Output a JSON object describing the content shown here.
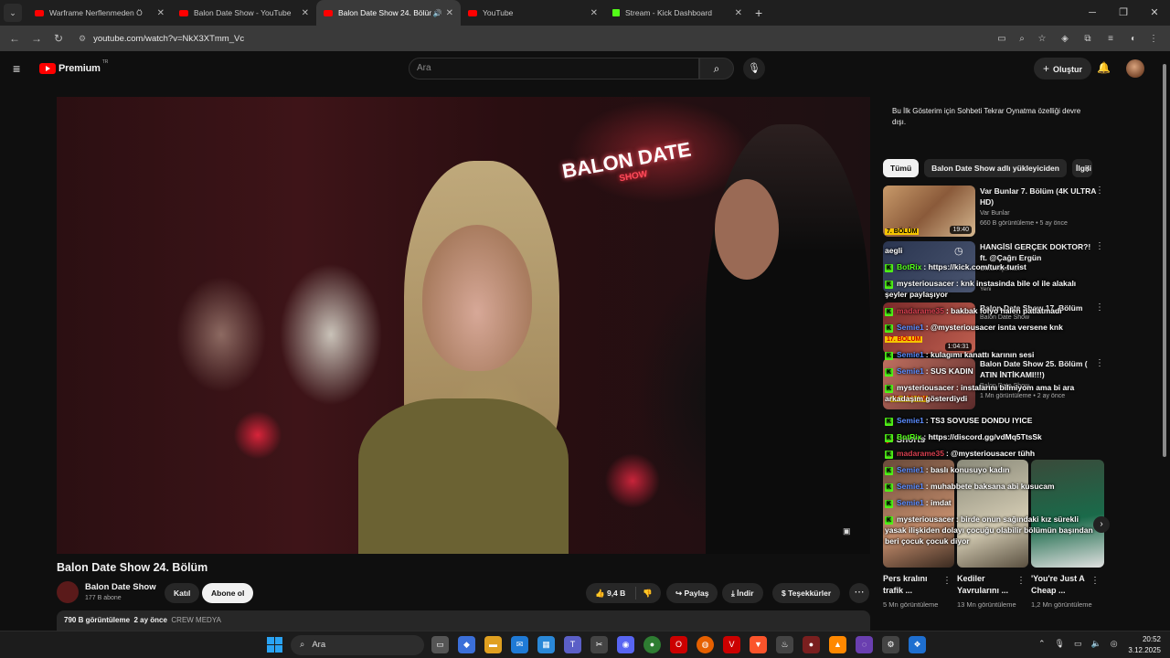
{
  "browser": {
    "tabs": [
      {
        "label": "Warframe Nerflenmeden Ö",
        "favicon": "youtube",
        "active": false
      },
      {
        "label": "Balon Date Show - YouTube",
        "favicon": "youtube",
        "active": false
      },
      {
        "label": "Balon Date Show 24. Bölüm",
        "favicon": "youtube",
        "active": true
      },
      {
        "label": "YouTube",
        "favicon": "youtube",
        "active": false
      },
      {
        "label": "Stream - Kick Dashboard",
        "favicon": "kick",
        "active": false
      }
    ],
    "url": "youtube.com/watch?v=NkX3XTmm_Vc"
  },
  "header": {
    "brand": "Premium",
    "country": "TR",
    "search_placeholder": "Ara",
    "create_label": "Oluştur"
  },
  "video": {
    "title": "Balon Date Show 24. Bölüm",
    "neon_text": "BALON DATE",
    "neon_sub": "SHOW",
    "channel": "Balon Date Show",
    "subscribers": "177 B abone",
    "join_label": "Katıl",
    "subscribe_label": "Abone ol",
    "likes": "9,4 B",
    "share_label": "Paylaş",
    "download_label": "İndir",
    "thanks_label": "Teşekkürler",
    "views": "790 B görüntüleme",
    "age": "2 ay önce",
    "tag": "CREW MEDYA"
  },
  "sidebar": {
    "chat_notice": "Bu İlk Gösterim için Sohbeti Tekrar Oynatma özelliği devre dışı.",
    "chips": [
      "Tümü",
      "Balon Date Show adlı yükleyiciden",
      "İlgili"
    ],
    "recommendations": [
      {
        "title": "Var Bunlar 7. Bölüm (4K ULTRA HD)",
        "channel": "Var Bunlar",
        "meta": "660 B görüntüleme • 5 ay önce",
        "duration": "19:40",
        "badge": "7. BÖLÜM"
      },
      {
        "title": "HANGİSİ GERÇEK DOKTOR?! ft. @Çağrı Ergün",
        "channel": "Orkun Işıtmak",
        "meta": "Yeni",
        "duration": ""
      },
      {
        "title": "Balon Date Show 17. Bölüm",
        "channel": "Balon Date Show",
        "meta": "",
        "duration": "1:04:31",
        "badge": "17. BÖLÜM"
      },
      {
        "title": "Balon Date Show 25. Bölüm ( ATIN İNTİKAMI!!!)",
        "channel": "Balon Date Show",
        "meta": "1 Mn görüntüleme • 2 ay önce",
        "duration": "",
        "badge": "25. BÖLÜM"
      }
    ],
    "shorts_label": "Shorts",
    "shorts": [
      {
        "title": "Pers kralını trafik ...",
        "views": "5 Mn görüntüleme"
      },
      {
        "title": "Kediler Yavrularını ...",
        "views": "13 Mn görüntüleme"
      },
      {
        "title": "'You're Just A Cheap ...",
        "views": "1,2 Mn görüntüleme"
      }
    ]
  },
  "chat_overlay": [
    {
      "user": "",
      "text": "aegli",
      "user_color": "#ffffff"
    },
    {
      "user": "BotRix",
      "text": ": https://kick.com/turk-turist",
      "user_color": "#53fc18"
    },
    {
      "user": "mysteriousacer",
      "text": ": knk instasinda bile ol ile alakalı",
      "user_color": "#ffffff"
    },
    {
      "user": "",
      "text": "şeyler paylaşıyor",
      "user_color": "#ffffff"
    },
    {
      "user": "madarame35",
      "text": ": bakbak folyo halen patlatmadı",
      "user_color": "#d63f4f"
    },
    {
      "user": "Semie1",
      "text": ": @mysteriousacer isnta versene knk",
      "user_color": "#5b8cff"
    },
    {
      "user": "Semie1",
      "text": ": kulagımı kanattı karının sesi",
      "user_color": "#5b8cff"
    },
    {
      "user": "Semie1",
      "text": ": SUS KADIN",
      "user_color": "#5b8cff"
    },
    {
      "user": "mysteriousacer",
      "text": ": instalarını bilmiyom ama bi ara",
      "user_color": "#ffffff"
    },
    {
      "user": "",
      "text": "arkadaşım gösterdiydi",
      "user_color": "#ffffff"
    },
    {
      "user": "Semie1",
      "text": ": TS3 SOVUSE DONDU IYICE",
      "user_color": "#5b8cff"
    },
    {
      "user": "BotRix",
      "text": ": https://discord.gg/vdMq5TtsSk",
      "user_color": "#53fc18"
    },
    {
      "user": "madarame35",
      "text": ": @mysteriousacer tühh",
      "user_color": "#d63f4f"
    },
    {
      "user": "Semie1",
      "text": ": baslı konusuyo kadın",
      "user_color": "#5b8cff"
    },
    {
      "user": "Semie1",
      "text": ": muhabbete baksana abi kusucam",
      "user_color": "#5b8cff"
    },
    {
      "user": "Semie1",
      "text": ": imdat",
      "user_color": "#5b8cff"
    },
    {
      "user": "mysteriousacer",
      "text": ": birde onun sağındaki kız sürekli",
      "user_color": "#ffffff"
    },
    {
      "user": "",
      "text": "yasak ilişkiden dolayı çocuğu olabilir bölümün başından",
      "user_color": "#ffffff"
    },
    {
      "user": "",
      "text": "beri çocuk çocuk diyor",
      "user_color": "#ffffff"
    }
  ],
  "taskbar": {
    "search_label": "Ara",
    "time": "20:52",
    "date": "3.12.2025"
  },
  "colors": {
    "youtube_red": "#ff0000",
    "kick_green": "#53fc18",
    "background": "#0f0f0f"
  }
}
